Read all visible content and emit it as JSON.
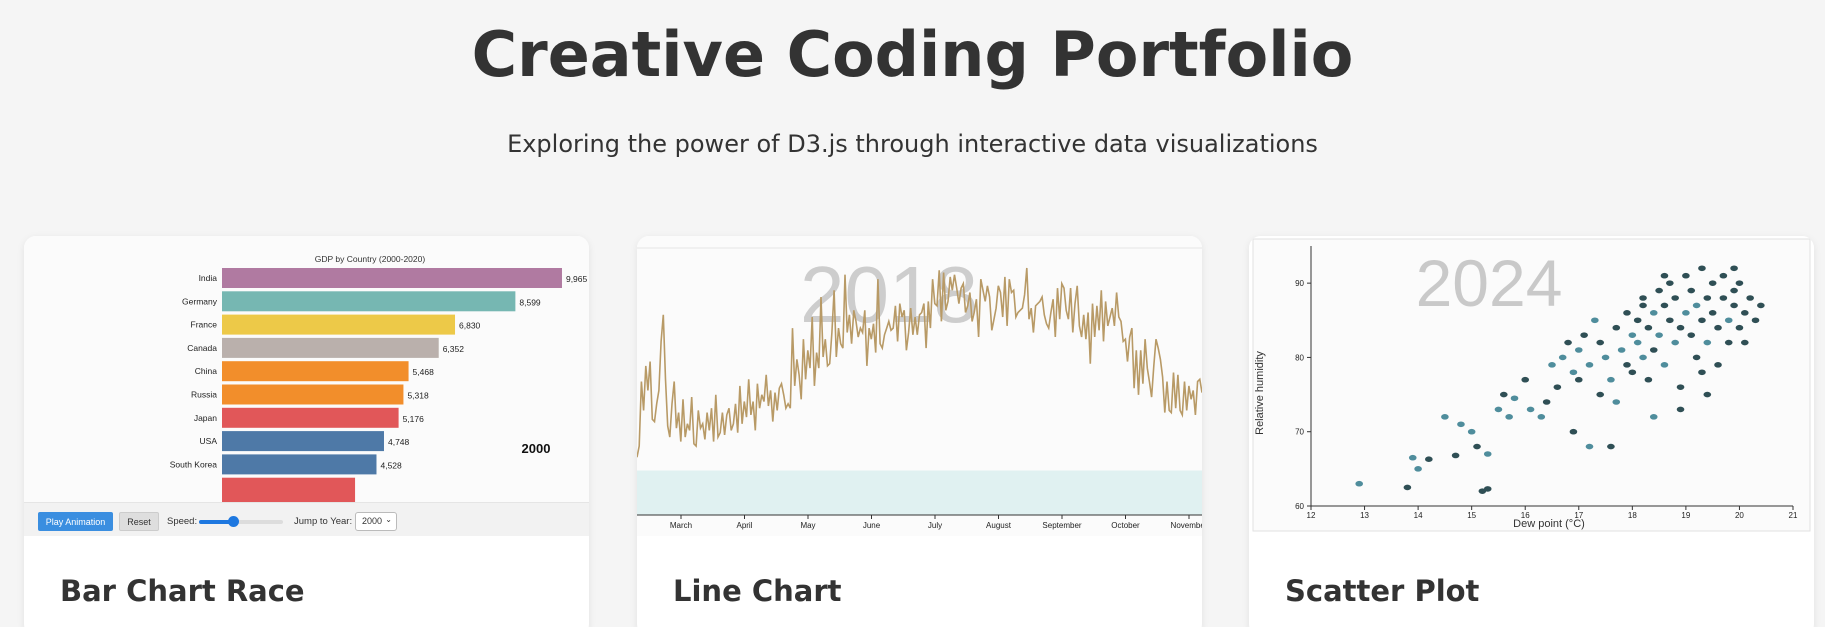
{
  "page": {
    "title": "Creative Coding Portfolio",
    "subtitle": "Exploring the power of D3.js through interactive data visualizations"
  },
  "cards": [
    {
      "title": "Bar Chart Race"
    },
    {
      "title": "Line Chart"
    },
    {
      "title": "Scatter Plot"
    }
  ],
  "bar_race_controls": {
    "play_label": "Play Animation",
    "reset_label": "Reset",
    "speed_label": "Speed:",
    "speed_value": 0.4,
    "jump_label": "Jump to Year:",
    "selected_year": "2000",
    "accent_color": "#3a8ee0"
  },
  "chart_data": [
    {
      "type": "bar",
      "title": "GDP by Country (2000-2020)",
      "year_label": "2000",
      "categories": [
        "India",
        "Germany",
        "France",
        "Canada",
        "China",
        "Russia",
        "Japan",
        "USA",
        "South Korea"
      ],
      "values": [
        9965,
        8599,
        6830,
        6352,
        5468,
        5318,
        5176,
        4748,
        4528
      ],
      "value_labels": [
        "9,965",
        "8,599",
        "6,830",
        "6,352",
        "5,468",
        "5,318",
        "5,176",
        "4,748",
        "4,528"
      ],
      "colors": [
        "#b07aa1",
        "#76b7b2",
        "#edc948",
        "#bab0ac",
        "#f28e2b",
        "#f28e2b",
        "#e15759",
        "#4e79a7",
        "#4e79a7"
      ],
      "partial_bar": {
        "value": 3900,
        "color": "#e15759"
      },
      "xlim": [
        0,
        10200
      ]
    },
    {
      "type": "line",
      "year_label": "2018",
      "x_tick_labels": [
        "March",
        "April",
        "May",
        "June",
        "July",
        "August",
        "September",
        "October",
        "November"
      ],
      "ylim": [
        -20,
        100
      ],
      "band": [
        -20,
        0
      ],
      "line_color": "#b89a66",
      "band_color": "#e0f1f1",
      "y_values": [
        6,
        11,
        40,
        27,
        47,
        36,
        49,
        23,
        22,
        30,
        36,
        58,
        70,
        41,
        20,
        15,
        30,
        40,
        19,
        26,
        13,
        32,
        15,
        21,
        18,
        33,
        12,
        11,
        27,
        19,
        21,
        14,
        26,
        18,
        28,
        13,
        34,
        15,
        17,
        26,
        16,
        25,
        28,
        18,
        21,
        30,
        17,
        38,
        21,
        31,
        24,
        41,
        25,
        31,
        18,
        39,
        28,
        34,
        31,
        43,
        29,
        36,
        22,
        35,
        27,
        37,
        39,
        34,
        28,
        30,
        28,
        64,
        38,
        50,
        43,
        32,
        59,
        41,
        54,
        46,
        69,
        38,
        53,
        46,
        78,
        51,
        59,
        47,
        48,
        62,
        81,
        51,
        64,
        57,
        55,
        88,
        62,
        70,
        57,
        72,
        67,
        60,
        64,
        62,
        72,
        47,
        64,
        59,
        66,
        53,
        86,
        57,
        55,
        61,
        64,
        67,
        63,
        64,
        74,
        58,
        75,
        69,
        72,
        54,
        62,
        73,
        61,
        69,
        61,
        70,
        71,
        75,
        55,
        76,
        64,
        86,
        75,
        74,
        90,
        67,
        89,
        72,
        76,
        87,
        81,
        88,
        82,
        75,
        82,
        84,
        71,
        74,
        80,
        67,
        71,
        77,
        60,
        86,
        81,
        76,
        83,
        78,
        63,
        68,
        73,
        83,
        80,
        69,
        87,
        65,
        86,
        80,
        81,
        69,
        71,
        72,
        73,
        79,
        91,
        68,
        73,
        62,
        74,
        75,
        76,
        78,
        70,
        66,
        64,
        71,
        77,
        60,
        82,
        68,
        84,
        82,
        72,
        68,
        82,
        62,
        75,
        83,
        65,
        60,
        70,
        59,
        71,
        48,
        75,
        60,
        74,
        63,
        81,
        58,
        76,
        65,
        69,
        73,
        65,
        80,
        69,
        67,
        58,
        59,
        49,
        60,
        64,
        37,
        54,
        34,
        54,
        39,
        59,
        46,
        40,
        33,
        47,
        59,
        55,
        50,
        42,
        26,
        40,
        27,
        26,
        44,
        28,
        43,
        27,
        25,
        40,
        27,
        38,
        32,
        36,
        25,
        40,
        41,
        35
      ]
    },
    {
      "type": "scatter",
      "year_label": "2024",
      "xlabel": "Dew point (°C)",
      "ylabel": "Relative humidity",
      "xlim": [
        12,
        21
      ],
      "ylim": [
        60,
        95
      ],
      "x_ticks": [
        "12",
        "13",
        "14",
        "15",
        "16",
        "17",
        "18",
        "19",
        "20",
        "21"
      ],
      "y_ticks": [
        "60",
        "70",
        "80",
        "90"
      ],
      "point_colors": [
        "#2f4f55",
        "#4f8d9c"
      ],
      "points": [
        [
          12.9,
          63,
          1
        ],
        [
          13.8,
          62.5,
          0
        ],
        [
          13.9,
          66.5,
          1
        ],
        [
          14.0,
          65,
          1
        ],
        [
          14.2,
          66.3,
          0
        ],
        [
          14.5,
          72,
          1
        ],
        [
          14.7,
          66.8,
          0
        ],
        [
          14.8,
          71,
          1
        ],
        [
          15.0,
          70,
          1
        ],
        [
          15.1,
          68,
          0
        ],
        [
          15.3,
          67,
          1
        ],
        [
          15.2,
          62,
          0
        ],
        [
          15.3,
          62.3,
          0
        ],
        [
          15.5,
          73,
          1
        ],
        [
          15.6,
          75,
          0
        ],
        [
          15.7,
          72,
          1
        ],
        [
          15.8,
          74.5,
          1
        ],
        [
          16.0,
          77,
          0
        ],
        [
          16.1,
          73,
          1
        ],
        [
          16.3,
          72,
          1
        ],
        [
          16.4,
          74,
          0
        ],
        [
          16.5,
          79,
          1
        ],
        [
          16.6,
          76,
          0
        ],
        [
          16.7,
          80,
          1
        ],
        [
          16.9,
          70,
          0
        ],
        [
          16.9,
          78,
          1
        ],
        [
          17.0,
          81,
          1
        ],
        [
          17.0,
          77,
          0
        ],
        [
          17.1,
          83,
          0
        ],
        [
          17.2,
          68,
          1
        ],
        [
          17.2,
          79,
          1
        ],
        [
          17.4,
          82,
          0
        ],
        [
          17.4,
          75,
          0
        ],
        [
          17.5,
          80,
          1
        ],
        [
          17.6,
          77,
          1
        ],
        [
          17.7,
          84,
          0
        ],
        [
          17.7,
          74,
          1
        ],
        [
          17.8,
          81,
          1
        ],
        [
          17.9,
          79,
          0
        ],
        [
          17.9,
          86,
          0
        ],
        [
          18.0,
          83,
          1
        ],
        [
          18.0,
          78,
          0
        ],
        [
          18.1,
          85,
          0
        ],
        [
          18.1,
          82,
          1
        ],
        [
          18.2,
          88,
          0
        ],
        [
          18.2,
          80,
          1
        ],
        [
          18.3,
          84,
          0
        ],
        [
          18.3,
          77,
          0
        ],
        [
          18.4,
          86,
          1
        ],
        [
          18.4,
          81,
          0
        ],
        [
          18.5,
          89,
          0
        ],
        [
          18.5,
          83,
          1
        ],
        [
          18.6,
          87,
          0
        ],
        [
          18.6,
          79,
          1
        ],
        [
          18.7,
          85,
          0
        ],
        [
          18.7,
          90,
          0
        ],
        [
          18.8,
          82,
          1
        ],
        [
          18.8,
          88,
          0
        ],
        [
          18.9,
          84,
          0
        ],
        [
          18.9,
          76,
          0
        ],
        [
          19.0,
          86,
          1
        ],
        [
          19.0,
          91,
          0
        ],
        [
          19.1,
          83,
          0
        ],
        [
          19.1,
          89,
          0
        ],
        [
          19.2,
          87,
          1
        ],
        [
          19.2,
          80,
          0
        ],
        [
          19.3,
          85,
          0
        ],
        [
          19.3,
          92,
          0
        ],
        [
          19.4,
          88,
          0
        ],
        [
          19.4,
          82,
          1
        ],
        [
          19.5,
          86,
          0
        ],
        [
          19.5,
          90,
          0
        ],
        [
          19.6,
          84,
          0
        ],
        [
          19.6,
          79,
          0
        ],
        [
          19.7,
          88,
          0
        ],
        [
          19.7,
          91,
          0
        ],
        [
          19.8,
          85,
          1
        ],
        [
          19.8,
          82,
          0
        ],
        [
          19.9,
          89,
          0
        ],
        [
          19.9,
          87,
          0
        ],
        [
          20.0,
          84,
          0
        ],
        [
          20.0,
          90,
          0
        ],
        [
          20.1,
          86,
          0
        ],
        [
          20.1,
          82,
          0
        ],
        [
          20.2,
          88,
          0
        ],
        [
          20.3,
          85,
          0
        ],
        [
          20.4,
          87,
          0
        ],
        [
          18.9,
          73,
          0
        ],
        [
          19.4,
          75,
          0
        ],
        [
          18.4,
          72,
          1
        ],
        [
          17.6,
          68,
          0
        ],
        [
          18.2,
          87,
          0
        ],
        [
          18.6,
          91,
          0
        ],
        [
          19.9,
          92,
          0
        ],
        [
          17.3,
          85,
          1
        ],
        [
          16.8,
          82,
          0
        ],
        [
          19.3,
          78,
          0
        ]
      ]
    }
  ]
}
